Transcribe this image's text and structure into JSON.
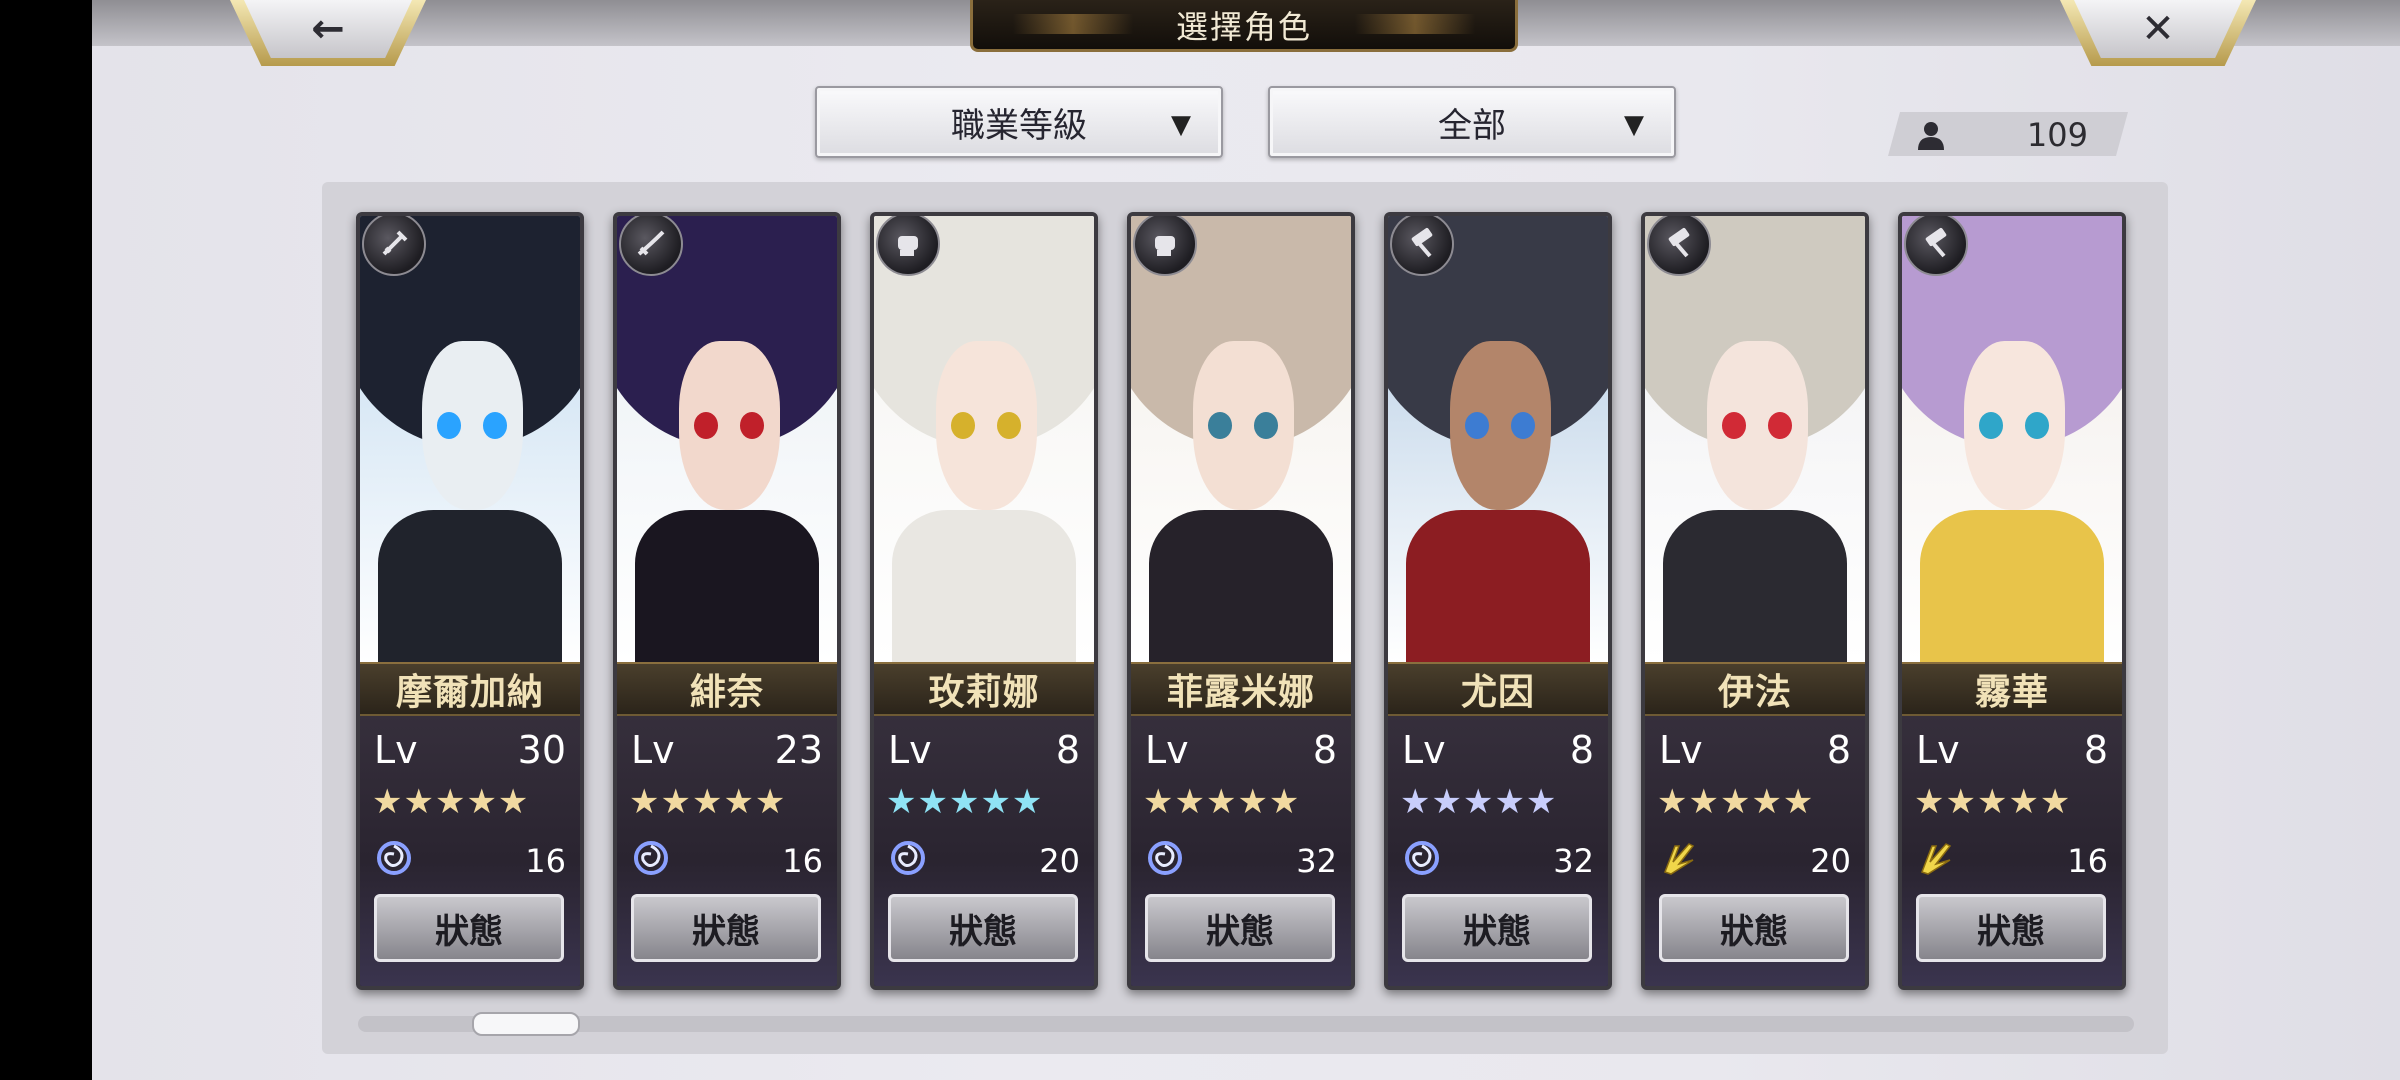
{
  "header": {
    "title": "選擇角色",
    "back_glyph": "←",
    "close_glyph": "✕"
  },
  "filters": {
    "sort_label": "職業等級",
    "category_label": "全部",
    "arrow": "▼"
  },
  "roster_count": "109",
  "labels": {
    "lv": "Lv",
    "status": "狀態"
  },
  "characters": [
    {
      "name": "摩爾加納",
      "level": "30",
      "stars": "★★★★★",
      "star_color": "#f1d9a0",
      "element": "spiral-icon",
      "stat": "16",
      "class_icon": "sword-icon"
    },
    {
      "name": "緋奈",
      "level": "23",
      "stars": "★★★★★",
      "star_color": "#f1d9a0",
      "element": "spiral-icon",
      "stat": "16",
      "class_icon": "katana-icon"
    },
    {
      "name": "玫莉娜",
      "level": "8",
      "stars": "★★★★★",
      "star_color": "#8fe3f5",
      "element": "spiral-icon",
      "stat": "20",
      "class_icon": "fist-icon"
    },
    {
      "name": "菲露米娜",
      "level": "8",
      "stars": "★★★★★",
      "star_color": "#f1d9a0",
      "element": "spiral-icon",
      "stat": "32",
      "class_icon": "fist-icon"
    },
    {
      "name": "尤因",
      "level": "8",
      "stars": "★★★★★",
      "star_color": "#c8cdfb",
      "element": "spiral-icon",
      "stat": "32",
      "class_icon": "hammer-icon"
    },
    {
      "name": "伊法",
      "level": "8",
      "stars": "★★★★★",
      "star_color": "#f1d9a0",
      "element": "lightning-wing-icon",
      "stat": "20",
      "class_icon": "hammer-icon"
    },
    {
      "name": "霧華",
      "level": "8",
      "stars": "★★★★★",
      "star_color": "#f1d9a0",
      "element": "lightning-wing-icon",
      "stat": "16",
      "class_icon": "hammer-icon"
    }
  ],
  "colors": {
    "spiral": "#8aa0ff",
    "lightning": "#f0d64a",
    "gold_trim": "#b69a4c"
  }
}
